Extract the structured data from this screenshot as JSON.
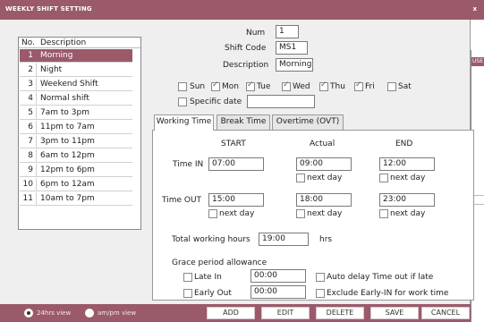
{
  "window": {
    "title": "WEEKLY SHIFT SETTING",
    "close": "x"
  },
  "list": {
    "header_no": "No.",
    "header_desc": "Description",
    "rows": [
      {
        "no": "1",
        "desc": "Morning"
      },
      {
        "no": "2",
        "desc": "Night"
      },
      {
        "no": "3",
        "desc": "Weekend Shift"
      },
      {
        "no": "4",
        "desc": "Normal shift"
      },
      {
        "no": "5",
        "desc": "7am to 3pm"
      },
      {
        "no": "6",
        "desc": "11pm to 7am"
      },
      {
        "no": "7",
        "desc": "3pm to 11pm"
      },
      {
        "no": "8",
        "desc": "6am to 12pm"
      },
      {
        "no": "9",
        "desc": "12pm to 6pm"
      },
      {
        "no": "10",
        "desc": "6pm to 12am"
      },
      {
        "no": "11",
        "desc": "10am to 7pm"
      }
    ]
  },
  "form": {
    "num_label": "Num",
    "num_value": "1",
    "shift_code_label": "Shift Code",
    "shift_code_value": "MS1",
    "description_label": "Description",
    "description_value": "Morning",
    "days": {
      "sun": "Sun",
      "mon": "Mon",
      "tue": "Tue",
      "wed": "Wed",
      "thu": "Thu",
      "fri": "Fri",
      "sat": "Sat"
    },
    "specific_date_label": "Specific date",
    "specific_date_value": ""
  },
  "tabs": {
    "working": "Working Time",
    "break": "Break Time",
    "overtime": "Overtime (OVT)"
  },
  "working": {
    "col_start": "START",
    "col_actual": "Actual",
    "col_end": "END",
    "time_in_label": "Time IN",
    "time_out_label": "Time OUT",
    "time_in_start": "07:00",
    "time_in_actual": "09:00",
    "time_in_end": "12:00",
    "time_out_start": "15:00",
    "time_out_actual": "18:00",
    "time_out_end": "23:00",
    "next_day": "next day",
    "total_label": "Total working hours",
    "total_value": "19:00",
    "total_unit": "hrs",
    "grace_label": "Grace period allowance",
    "late_in_label": "Late In",
    "late_in_value": "00:00",
    "early_out_label": "Early Out",
    "early_out_value": "00:00",
    "auto_delay_label": "Auto delay Time out if late",
    "exclude_label": "Exclude Early-IN for work time"
  },
  "bottom": {
    "view24": "24hrs view",
    "view_ampm": "am/pm view",
    "add": "ADD",
    "edit": "EDIT",
    "delete": "DELETE",
    "save": "SAVE",
    "cancel": "CANCEL"
  },
  "background_window": {
    "title": "USE"
  },
  "colors": {
    "accent": "#9a5a6a"
  }
}
